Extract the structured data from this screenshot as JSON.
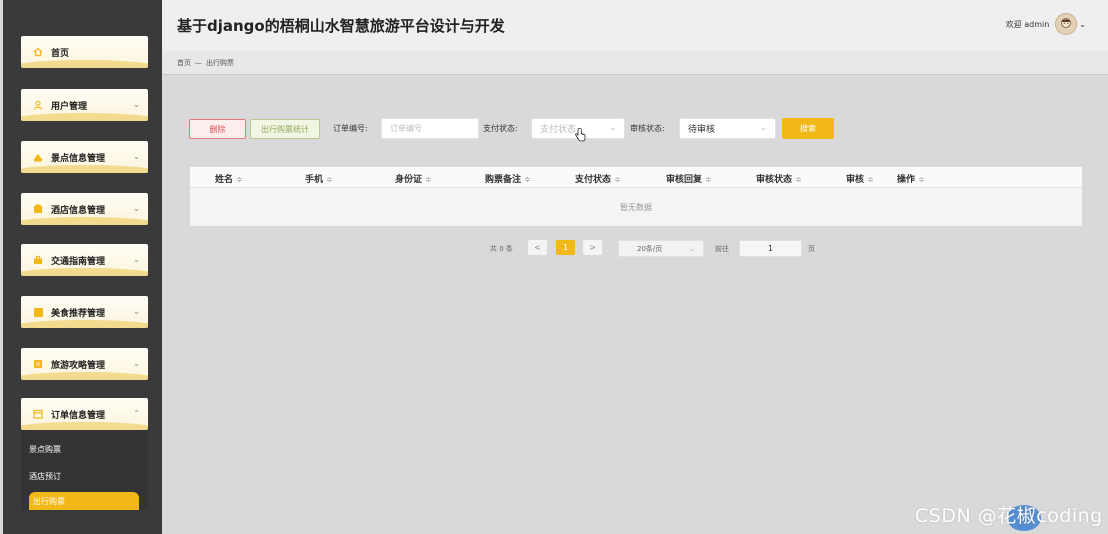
{
  "header": {
    "title": "基于django的梧桐山水智慧旅游平台设计与开发",
    "welcome": "欢迎 admin"
  },
  "breadcrumb": {
    "home": "首页",
    "sep": "—",
    "current": "出行购票"
  },
  "sidebar": {
    "items": [
      {
        "label": "首页"
      },
      {
        "label": "用户管理"
      },
      {
        "label": "景点信息管理"
      },
      {
        "label": "酒店信息管理"
      },
      {
        "label": "交通指南管理"
      },
      {
        "label": "美食推荐管理"
      },
      {
        "label": "旅游攻略管理"
      },
      {
        "label": "订单信息管理"
      }
    ],
    "submenu": [
      {
        "label": "景点购票"
      },
      {
        "label": "酒店预订"
      },
      {
        "label": "出行购票"
      }
    ]
  },
  "toolbar": {
    "delete_label": "删除",
    "stats_label": "出行购票统计",
    "order_no_label": "订单编号:",
    "order_no_placeholder": "订单编号",
    "pay_status_label": "支付状态:",
    "pay_status_placeholder": "支付状态",
    "review_status_label": "审核状态:",
    "review_status_value": "待审核",
    "search_label": "搜索"
  },
  "table": {
    "columns": [
      "姓名",
      "手机",
      "身份证",
      "购票备注",
      "支付状态",
      "审核回复",
      "审核状态",
      "审核",
      "操作"
    ],
    "empty_text": "暂无数据"
  },
  "pagination": {
    "total": "共 0 条",
    "prev": "<",
    "page": "1",
    "next": ">",
    "page_size": "20条/页",
    "goto_label": "前往",
    "goto_value": "1",
    "unit": "页"
  },
  "watermark": "CSDN @花椒coding",
  "colors": {
    "accent": "#f2b818",
    "sidebar_bg": "#3a3a3a",
    "danger": "#e05050"
  }
}
